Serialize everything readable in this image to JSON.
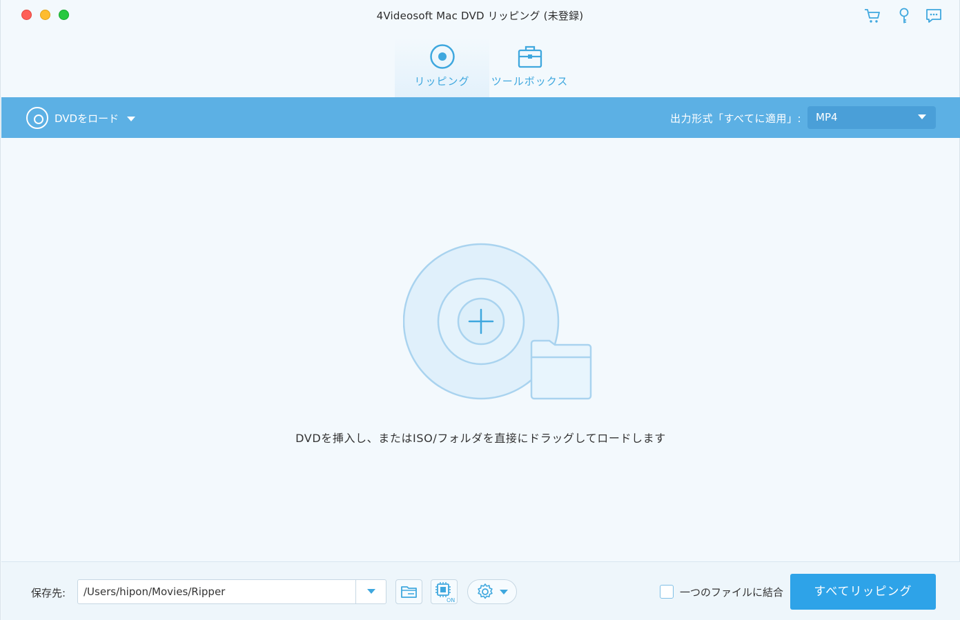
{
  "window": {
    "title": "4Videosoft Mac DVD リッピング (未登録)"
  },
  "top_icons": [
    "cart-icon",
    "key-icon",
    "feedback-icon"
  ],
  "tabs": [
    {
      "label": "リッピング",
      "icon": "disc-icon",
      "active": true
    },
    {
      "label": "ツールボックス",
      "icon": "toolbox-icon",
      "active": false
    }
  ],
  "toolbar": {
    "load_label": "DVDをロード",
    "format_label": "出力形式「すべてに適用」:",
    "format_value": "MP4"
  },
  "drop_area": {
    "hint": "DVDを挿入し、またはISO/フォルダを直接にドラッグしてロードします"
  },
  "bottom": {
    "save_label": "保存先:",
    "save_path": "/Users/hipon/Movies/Ripper",
    "merge_label": "一つのファイルに結合",
    "merge_checked": false,
    "rip_all_label": "すべてリッピング",
    "hw_accel_badge": "ON"
  },
  "colors": {
    "accent": "#3ea7de",
    "toolbar": "#5cb0e4",
    "primary_button": "#2ea3e8"
  }
}
